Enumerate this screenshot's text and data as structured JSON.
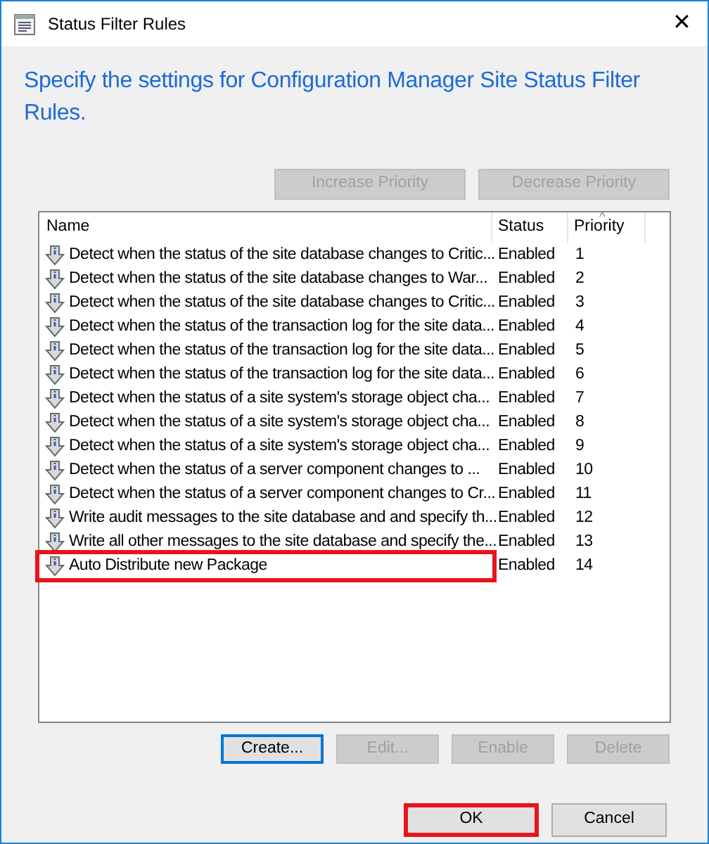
{
  "window": {
    "title": "Status Filter Rules",
    "close": "✕"
  },
  "heading": "Specify the settings for Configuration Manager Site Status Filter Rules.",
  "priority_buttons": [
    {
      "label": "Increase Priority",
      "disabled": true
    },
    {
      "label": "Decrease Priority",
      "disabled": true
    }
  ],
  "table": {
    "columns": [
      "Name",
      "Status",
      "Priority"
    ],
    "sort_indicator": "^",
    "rows": [
      {
        "name": "Detect when the status of the site database changes to Critic...",
        "status": "Enabled",
        "priority": "1",
        "highlighted": false
      },
      {
        "name": "Detect when the status of the site database changes to War...",
        "status": "Enabled",
        "priority": "2",
        "highlighted": false
      },
      {
        "name": "Detect when the status of the site database changes to Critic...",
        "status": "Enabled",
        "priority": "3",
        "highlighted": false
      },
      {
        "name": "Detect when the status of the transaction log for the site data...",
        "status": "Enabled",
        "priority": "4",
        "highlighted": false
      },
      {
        "name": "Detect when the status of the transaction log for the site data...",
        "status": "Enabled",
        "priority": "5",
        "highlighted": false
      },
      {
        "name": "Detect when the status of the transaction log for the site data...",
        "status": "Enabled",
        "priority": "6",
        "highlighted": false
      },
      {
        "name": "Detect when the status of a site system's storage object cha...",
        "status": "Enabled",
        "priority": "7",
        "highlighted": false
      },
      {
        "name": "Detect when the status of a site system's storage object cha...",
        "status": "Enabled",
        "priority": "8",
        "highlighted": false
      },
      {
        "name": "Detect when the status of a site system's storage object cha...",
        "status": "Enabled",
        "priority": "9",
        "highlighted": false
      },
      {
        "name": "Detect when the status of a server component changes to ...",
        "status": "Enabled",
        "priority": "10",
        "highlighted": false
      },
      {
        "name": "Detect when the status of a server component changes to Cr...",
        "status": "Enabled",
        "priority": "11",
        "highlighted": false
      },
      {
        "name": "Write audit messages to the site database and and specify th...",
        "status": "Enabled",
        "priority": "12",
        "highlighted": false
      },
      {
        "name": "Write all other messages to the site database and specify the...",
        "status": "Enabled",
        "priority": "13",
        "highlighted": false
      },
      {
        "name": "Auto Distribute new Package",
        "status": "Enabled",
        "priority": "14",
        "highlighted": true
      }
    ]
  },
  "action_buttons": [
    {
      "label": "Create...",
      "disabled": false,
      "focused": true
    },
    {
      "label": "Edit...",
      "disabled": true,
      "focused": false
    },
    {
      "label": "Enable",
      "disabled": true,
      "focused": false
    },
    {
      "label": "Delete",
      "disabled": true,
      "focused": false
    }
  ],
  "dialog_buttons": [
    {
      "label": "OK",
      "highlighted": true
    },
    {
      "label": "Cancel",
      "highlighted": false
    }
  ]
}
